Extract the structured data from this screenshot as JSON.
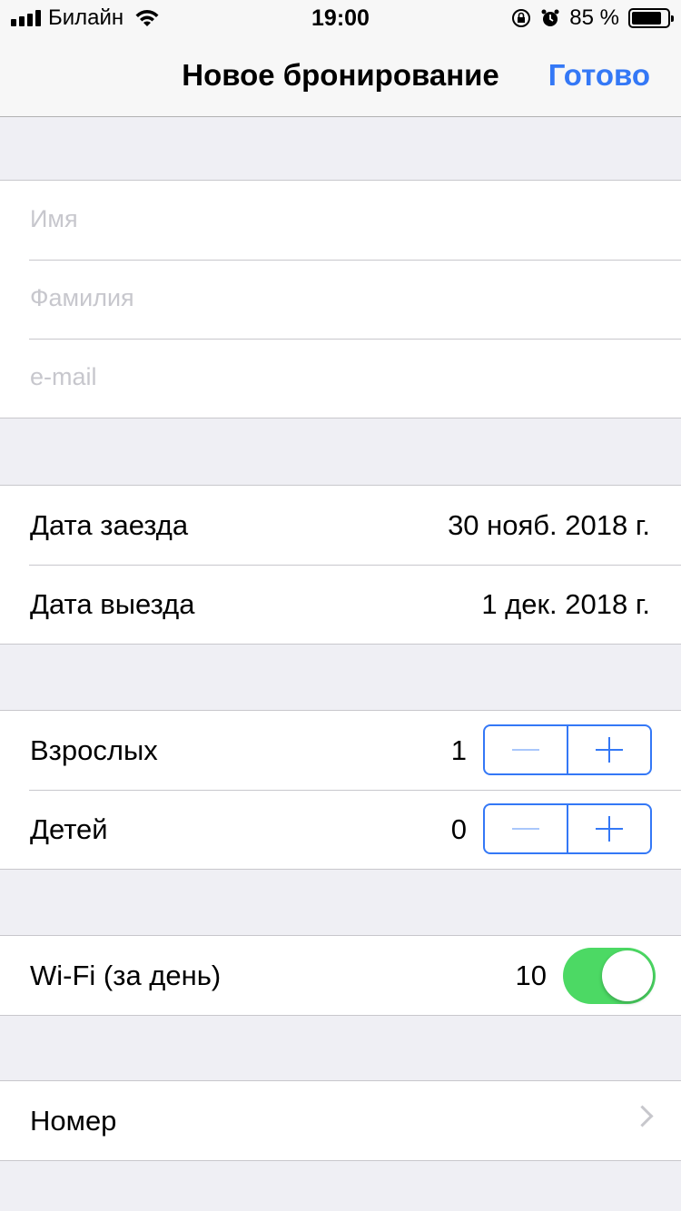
{
  "status_bar": {
    "carrier": "Билайн",
    "time": "19:00",
    "battery_percent": "85 %",
    "battery_level": 0.85
  },
  "nav": {
    "title": "Новое бронирование",
    "done_label": "Готово"
  },
  "guest": {
    "first_name_placeholder": "Имя",
    "last_name_placeholder": "Фамилия",
    "email_placeholder": "e-mail"
  },
  "dates": {
    "checkin_label": "Дата заезда",
    "checkin_value": "30 нояб. 2018 г.",
    "checkout_label": "Дата выезда",
    "checkout_value": "1 дек. 2018 г."
  },
  "guests_count": {
    "adults_label": "Взрослых",
    "adults_value": "1",
    "children_label": "Детей",
    "children_value": "0"
  },
  "wifi": {
    "label": "Wi-Fi (за день)",
    "price": "10",
    "enabled": true,
    "accent_color": "#4cd964"
  },
  "room": {
    "label": "Номер"
  },
  "colors": {
    "tint": "#3478f6",
    "background": "#efeff4",
    "placeholder": "#c7c7cd"
  }
}
